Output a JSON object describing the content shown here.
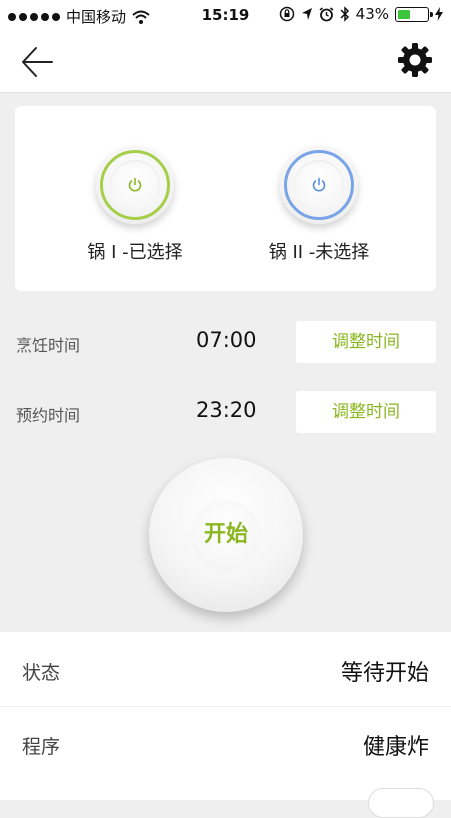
{
  "status_bar": {
    "carrier": "中国移动",
    "time": "15:19",
    "battery_percent": "43%",
    "battery_level": 0.43,
    "icons": [
      "signal-dots-icon",
      "wifi-icon",
      "rotation-lock-icon",
      "location-icon",
      "alarm-icon",
      "bluetooth-icon",
      "battery-icon",
      "charging-icon"
    ]
  },
  "nav": {
    "back_icon": "back-arrow-icon",
    "settings_icon": "gear-icon"
  },
  "pots": [
    {
      "label": "锅 I -已选择",
      "ring_color": "#a6cf49",
      "power_color": "#8ab721"
    },
    {
      "label": "锅 II -未选择",
      "ring_color": "#7aa4e8",
      "power_color": "#5b8fd9"
    }
  ],
  "cooking_time": {
    "label": "烹饪时间",
    "value": "07:00",
    "button": "调整时间"
  },
  "reservation_time": {
    "label": "预约时间",
    "value": "23:20",
    "button": "调整时间"
  },
  "start_button": {
    "label": "开始"
  },
  "info": [
    {
      "label": "状态",
      "value": "等待开始"
    },
    {
      "label": "程序",
      "value": "健康炸"
    }
  ],
  "colors": {
    "accent": "#8ab721",
    "background": "#efefef"
  }
}
